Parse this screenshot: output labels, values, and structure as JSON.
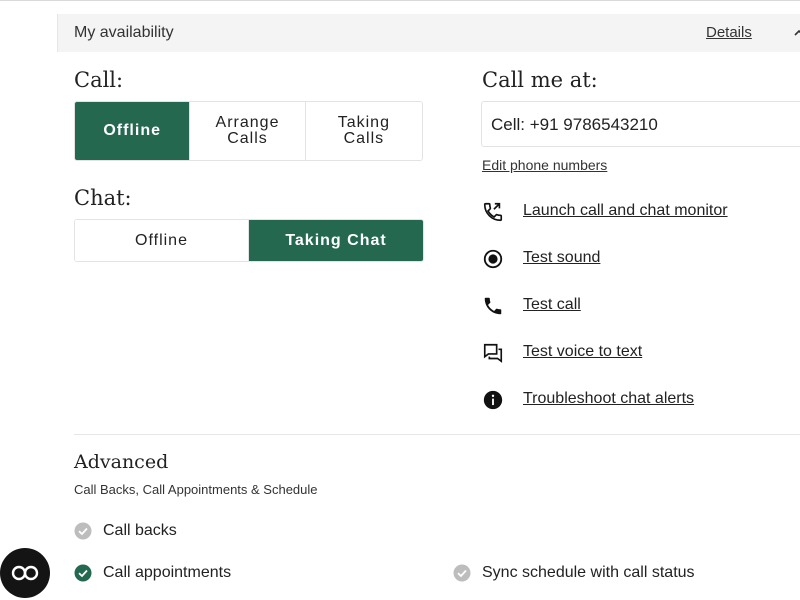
{
  "header": {
    "title": "My availability",
    "details_label": "Details"
  },
  "call": {
    "label": "Call:",
    "options": [
      "Offline",
      "Arrange\nCalls",
      "Taking\nCalls"
    ],
    "selected": "Offline"
  },
  "chat": {
    "label": "Chat:",
    "options": [
      "Offline",
      "Taking Chat"
    ],
    "selected": "Taking Chat"
  },
  "call_me": {
    "label": "Call me at:",
    "phone": "Cell: +91 9786543210",
    "edit_label": "Edit phone numbers"
  },
  "links": [
    {
      "label": "Launch call and chat monitor",
      "icon": "phone-forward-icon"
    },
    {
      "label": "Test sound",
      "icon": "record-icon"
    },
    {
      "label": "Test call",
      "icon": "phone-icon"
    },
    {
      "label": "Test voice to text",
      "icon": "chat-bubbles-icon"
    },
    {
      "label": "Troubleshoot chat alerts",
      "icon": "info-icon"
    }
  ],
  "advanced": {
    "title": "Advanced",
    "subtitle": "Call Backs, Call Appointments & Schedule",
    "items": [
      {
        "label": "Call backs",
        "checked": false
      },
      {
        "label": "Call appointments",
        "checked": true
      },
      {
        "label": "Sync schedule with call status",
        "checked": false
      }
    ]
  },
  "colors": {
    "accent": "#23684f",
    "check_inactive": "#bdbdbd",
    "fab": "#141414"
  },
  "fab": {
    "icon": "infinity-icon"
  }
}
